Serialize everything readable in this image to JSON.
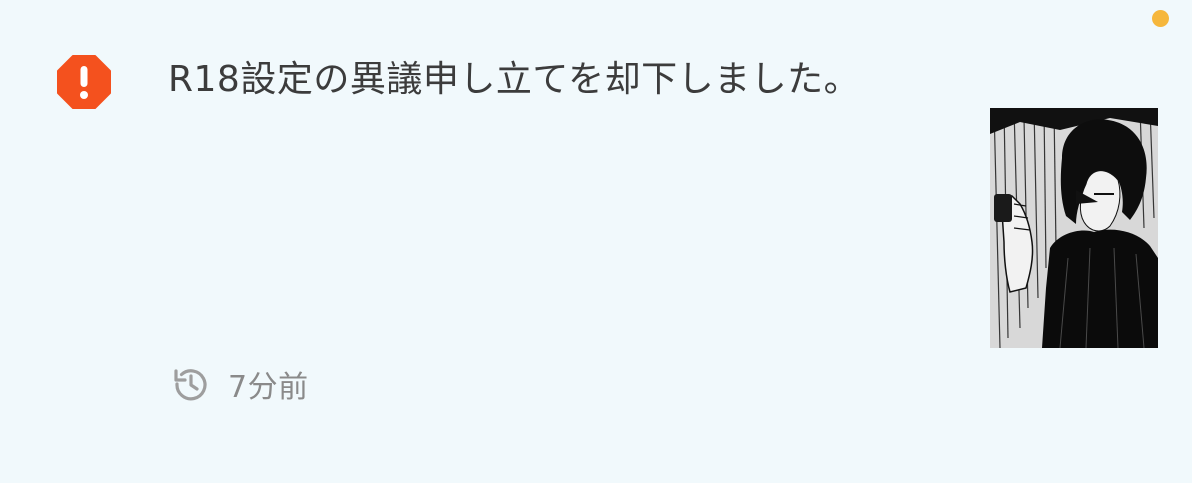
{
  "notification": {
    "message": "R18設定の異議申し立てを却下しました。",
    "timestamp": "7分前",
    "status_icon": "alert-octagon-icon",
    "time_icon": "history-clock-icon",
    "thumbnail": "manga-illustration-thumbnail",
    "unread": true
  },
  "colors": {
    "background": "#f1f9fc",
    "alert": "#f4511e",
    "unread_dot": "#f6b73c",
    "text": "#3c3c3c",
    "muted": "#8a8a8a"
  }
}
